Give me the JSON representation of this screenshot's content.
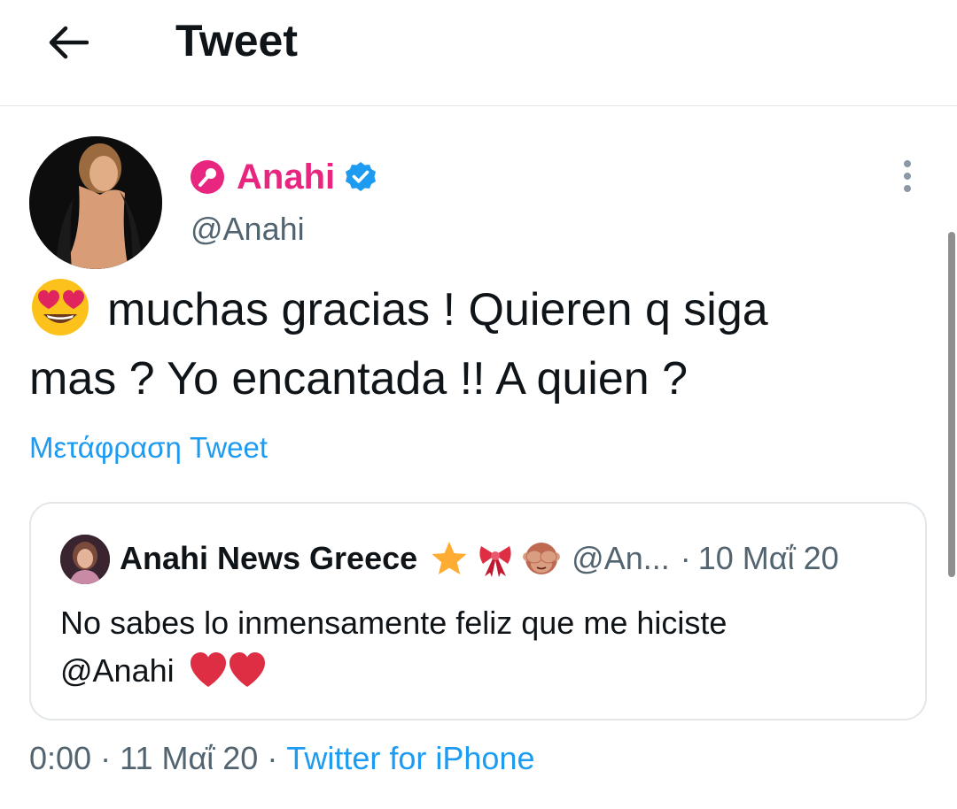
{
  "header": {
    "title": "Tweet",
    "back_icon": "arrow-left-icon"
  },
  "tweet": {
    "author": {
      "name": "Anahi",
      "handle": "@Anahi",
      "name_color": "#e8267f",
      "badge_icon": "microphone-badge-icon",
      "verified": true
    },
    "text_line1": "muchas gracias ! Quieren q siga",
    "text_line2": "mas ? Yo encantada !! A quien ?",
    "leading_emoji": "heart-eyes-emoji",
    "translate_label": "Μετάφραση Tweet",
    "time": "0:00",
    "date": "11 Μαΐ 20",
    "separator": "·",
    "source": "Twitter for iPhone"
  },
  "quote": {
    "author_name": "Anahi News Greece",
    "name_emojis": [
      "star-emoji",
      "ribbon-emoji",
      "see-no-evil-monkey-emoji"
    ],
    "handle": "@An...",
    "separator": "·",
    "date": "10 Μαΐ 20",
    "text_line1": "No sabes lo inmensamente feliz que me hiciste",
    "text_line2": "@Anahi",
    "trailing_emojis": [
      "red-heart-emoji",
      "red-heart-emoji"
    ]
  },
  "colors": {
    "link": "#1d9bf0",
    "secondary_text": "#536471",
    "border": "#e3e7ea"
  }
}
